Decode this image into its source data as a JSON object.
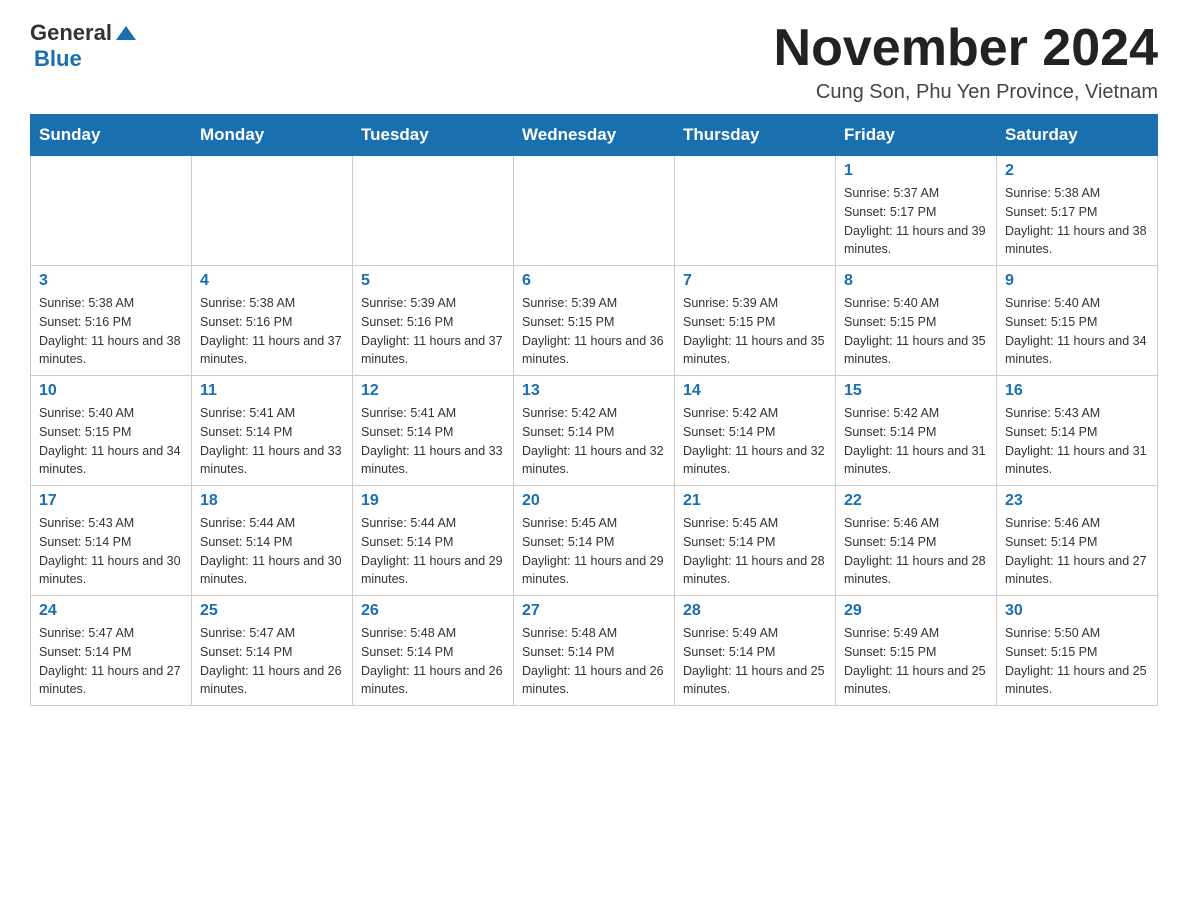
{
  "header": {
    "logo_general": "General",
    "logo_blue": "Blue",
    "month_title": "November 2024",
    "location": "Cung Son, Phu Yen Province, Vietnam"
  },
  "weekdays": [
    "Sunday",
    "Monday",
    "Tuesday",
    "Wednesday",
    "Thursday",
    "Friday",
    "Saturday"
  ],
  "weeks": [
    [
      {
        "day": "",
        "info": ""
      },
      {
        "day": "",
        "info": ""
      },
      {
        "day": "",
        "info": ""
      },
      {
        "day": "",
        "info": ""
      },
      {
        "day": "",
        "info": ""
      },
      {
        "day": "1",
        "info": "Sunrise: 5:37 AM\nSunset: 5:17 PM\nDaylight: 11 hours and 39 minutes."
      },
      {
        "day": "2",
        "info": "Sunrise: 5:38 AM\nSunset: 5:17 PM\nDaylight: 11 hours and 38 minutes."
      }
    ],
    [
      {
        "day": "3",
        "info": "Sunrise: 5:38 AM\nSunset: 5:16 PM\nDaylight: 11 hours and 38 minutes."
      },
      {
        "day": "4",
        "info": "Sunrise: 5:38 AM\nSunset: 5:16 PM\nDaylight: 11 hours and 37 minutes."
      },
      {
        "day": "5",
        "info": "Sunrise: 5:39 AM\nSunset: 5:16 PM\nDaylight: 11 hours and 37 minutes."
      },
      {
        "day": "6",
        "info": "Sunrise: 5:39 AM\nSunset: 5:15 PM\nDaylight: 11 hours and 36 minutes."
      },
      {
        "day": "7",
        "info": "Sunrise: 5:39 AM\nSunset: 5:15 PM\nDaylight: 11 hours and 35 minutes."
      },
      {
        "day": "8",
        "info": "Sunrise: 5:40 AM\nSunset: 5:15 PM\nDaylight: 11 hours and 35 minutes."
      },
      {
        "day": "9",
        "info": "Sunrise: 5:40 AM\nSunset: 5:15 PM\nDaylight: 11 hours and 34 minutes."
      }
    ],
    [
      {
        "day": "10",
        "info": "Sunrise: 5:40 AM\nSunset: 5:15 PM\nDaylight: 11 hours and 34 minutes."
      },
      {
        "day": "11",
        "info": "Sunrise: 5:41 AM\nSunset: 5:14 PM\nDaylight: 11 hours and 33 minutes."
      },
      {
        "day": "12",
        "info": "Sunrise: 5:41 AM\nSunset: 5:14 PM\nDaylight: 11 hours and 33 minutes."
      },
      {
        "day": "13",
        "info": "Sunrise: 5:42 AM\nSunset: 5:14 PM\nDaylight: 11 hours and 32 minutes."
      },
      {
        "day": "14",
        "info": "Sunrise: 5:42 AM\nSunset: 5:14 PM\nDaylight: 11 hours and 32 minutes."
      },
      {
        "day": "15",
        "info": "Sunrise: 5:42 AM\nSunset: 5:14 PM\nDaylight: 11 hours and 31 minutes."
      },
      {
        "day": "16",
        "info": "Sunrise: 5:43 AM\nSunset: 5:14 PM\nDaylight: 11 hours and 31 minutes."
      }
    ],
    [
      {
        "day": "17",
        "info": "Sunrise: 5:43 AM\nSunset: 5:14 PM\nDaylight: 11 hours and 30 minutes."
      },
      {
        "day": "18",
        "info": "Sunrise: 5:44 AM\nSunset: 5:14 PM\nDaylight: 11 hours and 30 minutes."
      },
      {
        "day": "19",
        "info": "Sunrise: 5:44 AM\nSunset: 5:14 PM\nDaylight: 11 hours and 29 minutes."
      },
      {
        "day": "20",
        "info": "Sunrise: 5:45 AM\nSunset: 5:14 PM\nDaylight: 11 hours and 29 minutes."
      },
      {
        "day": "21",
        "info": "Sunrise: 5:45 AM\nSunset: 5:14 PM\nDaylight: 11 hours and 28 minutes."
      },
      {
        "day": "22",
        "info": "Sunrise: 5:46 AM\nSunset: 5:14 PM\nDaylight: 11 hours and 28 minutes."
      },
      {
        "day": "23",
        "info": "Sunrise: 5:46 AM\nSunset: 5:14 PM\nDaylight: 11 hours and 27 minutes."
      }
    ],
    [
      {
        "day": "24",
        "info": "Sunrise: 5:47 AM\nSunset: 5:14 PM\nDaylight: 11 hours and 27 minutes."
      },
      {
        "day": "25",
        "info": "Sunrise: 5:47 AM\nSunset: 5:14 PM\nDaylight: 11 hours and 26 minutes."
      },
      {
        "day": "26",
        "info": "Sunrise: 5:48 AM\nSunset: 5:14 PM\nDaylight: 11 hours and 26 minutes."
      },
      {
        "day": "27",
        "info": "Sunrise: 5:48 AM\nSunset: 5:14 PM\nDaylight: 11 hours and 26 minutes."
      },
      {
        "day": "28",
        "info": "Sunrise: 5:49 AM\nSunset: 5:14 PM\nDaylight: 11 hours and 25 minutes."
      },
      {
        "day": "29",
        "info": "Sunrise: 5:49 AM\nSunset: 5:15 PM\nDaylight: 11 hours and 25 minutes."
      },
      {
        "day": "30",
        "info": "Sunrise: 5:50 AM\nSunset: 5:15 PM\nDaylight: 11 hours and 25 minutes."
      }
    ]
  ]
}
